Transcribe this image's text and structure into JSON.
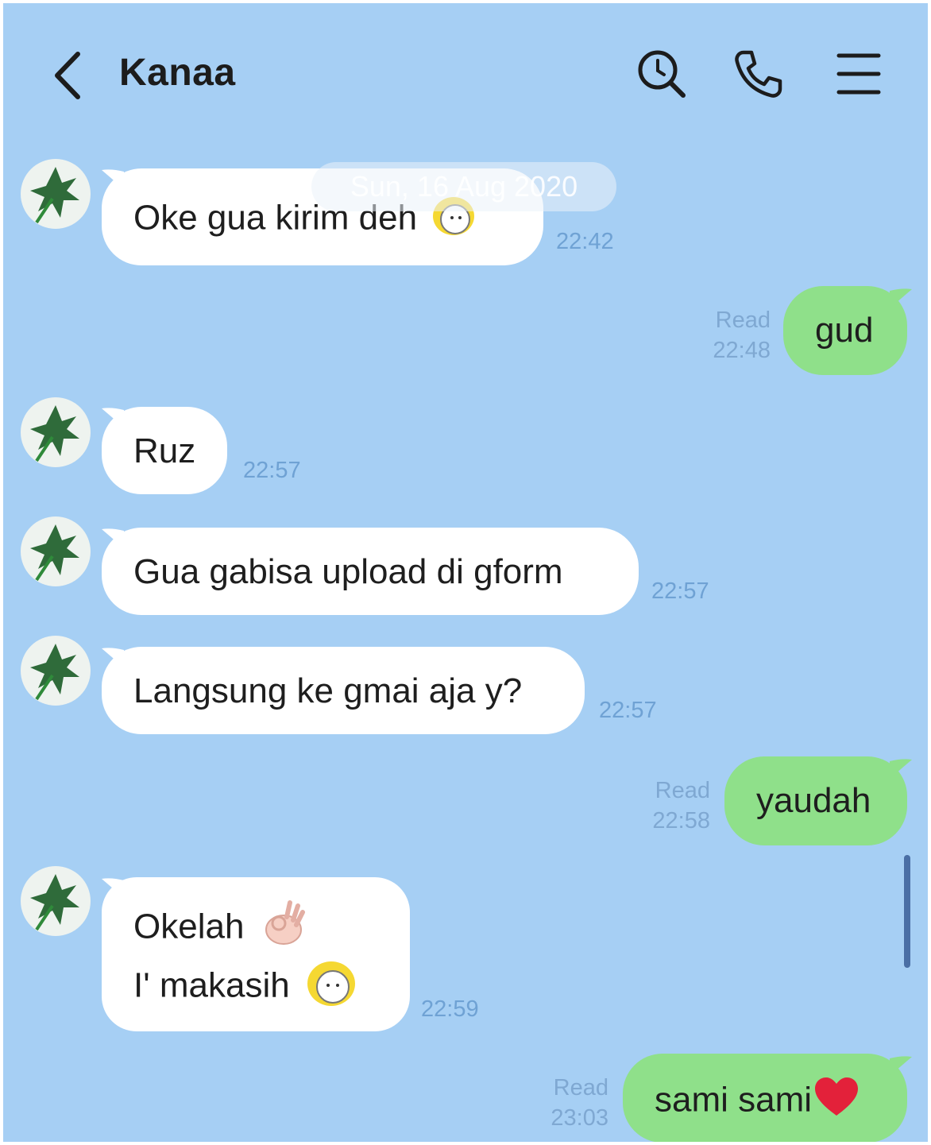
{
  "header": {
    "title": "Kanaa",
    "icons": [
      "back-arrow-icon",
      "search-icon",
      "phone-icon",
      "menu-icon"
    ]
  },
  "date_separator": "Sun, 16 Aug 2020",
  "messages": [
    {
      "from": "contact",
      "text": "Oke gua kirim deh",
      "time": "22:42",
      "emoji": "girl-sticker-icon"
    },
    {
      "from": "me",
      "text": "gud",
      "read": "Read",
      "time": "22:48"
    },
    {
      "from": "contact",
      "text": "Ruz",
      "time": "22:57"
    },
    {
      "from": "contact",
      "text": "Gua gabisa upload di gform",
      "time": "22:57"
    },
    {
      "from": "contact",
      "text": "Langsung ke gmai aja y?",
      "time": "22:57"
    },
    {
      "from": "me",
      "text": "yaudah",
      "read": "Read",
      "time": "22:58"
    },
    {
      "from": "contact",
      "lines": [
        "Okelah",
        "I' makasih"
      ],
      "time": "22:59",
      "emojis": [
        "ok-hand-icon",
        "girl-sticker-icon"
      ]
    },
    {
      "from": "me",
      "text": "sami sami",
      "read": "Read",
      "time": "23:03",
      "emoji": "heart-icon"
    }
  ],
  "colors": {
    "background": "#a6cff4",
    "incoming_bubble": "#ffffff",
    "outgoing_bubble": "#8fe08a",
    "timestamp": "#6fa2d4"
  }
}
